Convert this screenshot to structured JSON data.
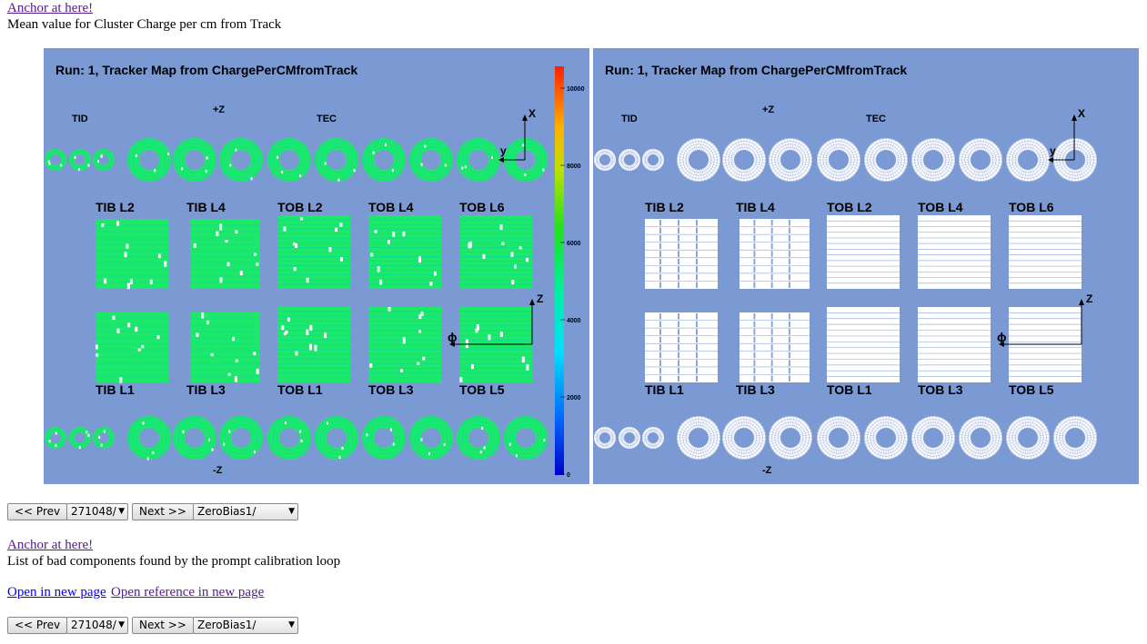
{
  "top_link": "Anchor at here!",
  "top_desc": "Mean value for Cluster Charge per cm from Track",
  "maps": {
    "left_title": "Run: 1, Tracker Map from ChargePerCMfromTrack",
    "right_title": "Run: 1, Tracker Map from ChargePerCMfromTrack",
    "tid": "TID",
    "tec": "TEC",
    "plus_z": "+Z",
    "minus_z": "-Z",
    "axis_x": "X",
    "axis_y": "y",
    "axis_z": "Z",
    "axis_phi": "ϕ",
    "upper_labels": [
      "TIB L2",
      "TIB L4",
      "TOB L2",
      "TOB L4",
      "TOB L6"
    ],
    "lower_labels": [
      "TIB L1",
      "TIB L3",
      "TOB L1",
      "TOB L3",
      "TOB L5"
    ],
    "colorbar_ticks": [
      "10000",
      "8000",
      "6000",
      "4000",
      "2000",
      "0"
    ]
  },
  "nav1": {
    "prev": "<< Prev",
    "run": "271048/",
    "next": "Next >>",
    "dataset": "ZeroBias1/"
  },
  "second_link": "Anchor at here!",
  "second_desc": "List of bad components found by the prompt calibration loop",
  "open_new": "Open in new page",
  "open_ref": "Open reference in new page",
  "nav2": {
    "prev": "<< Prev",
    "run": "271048/",
    "next": "Next >>",
    "dataset": "ZeroBias1/"
  },
  "colors": {
    "map_bg": "#7b99d3",
    "module_green": "#1de86a",
    "module_cyan": "#00f0b0",
    "ref_white": "#ffffff"
  }
}
